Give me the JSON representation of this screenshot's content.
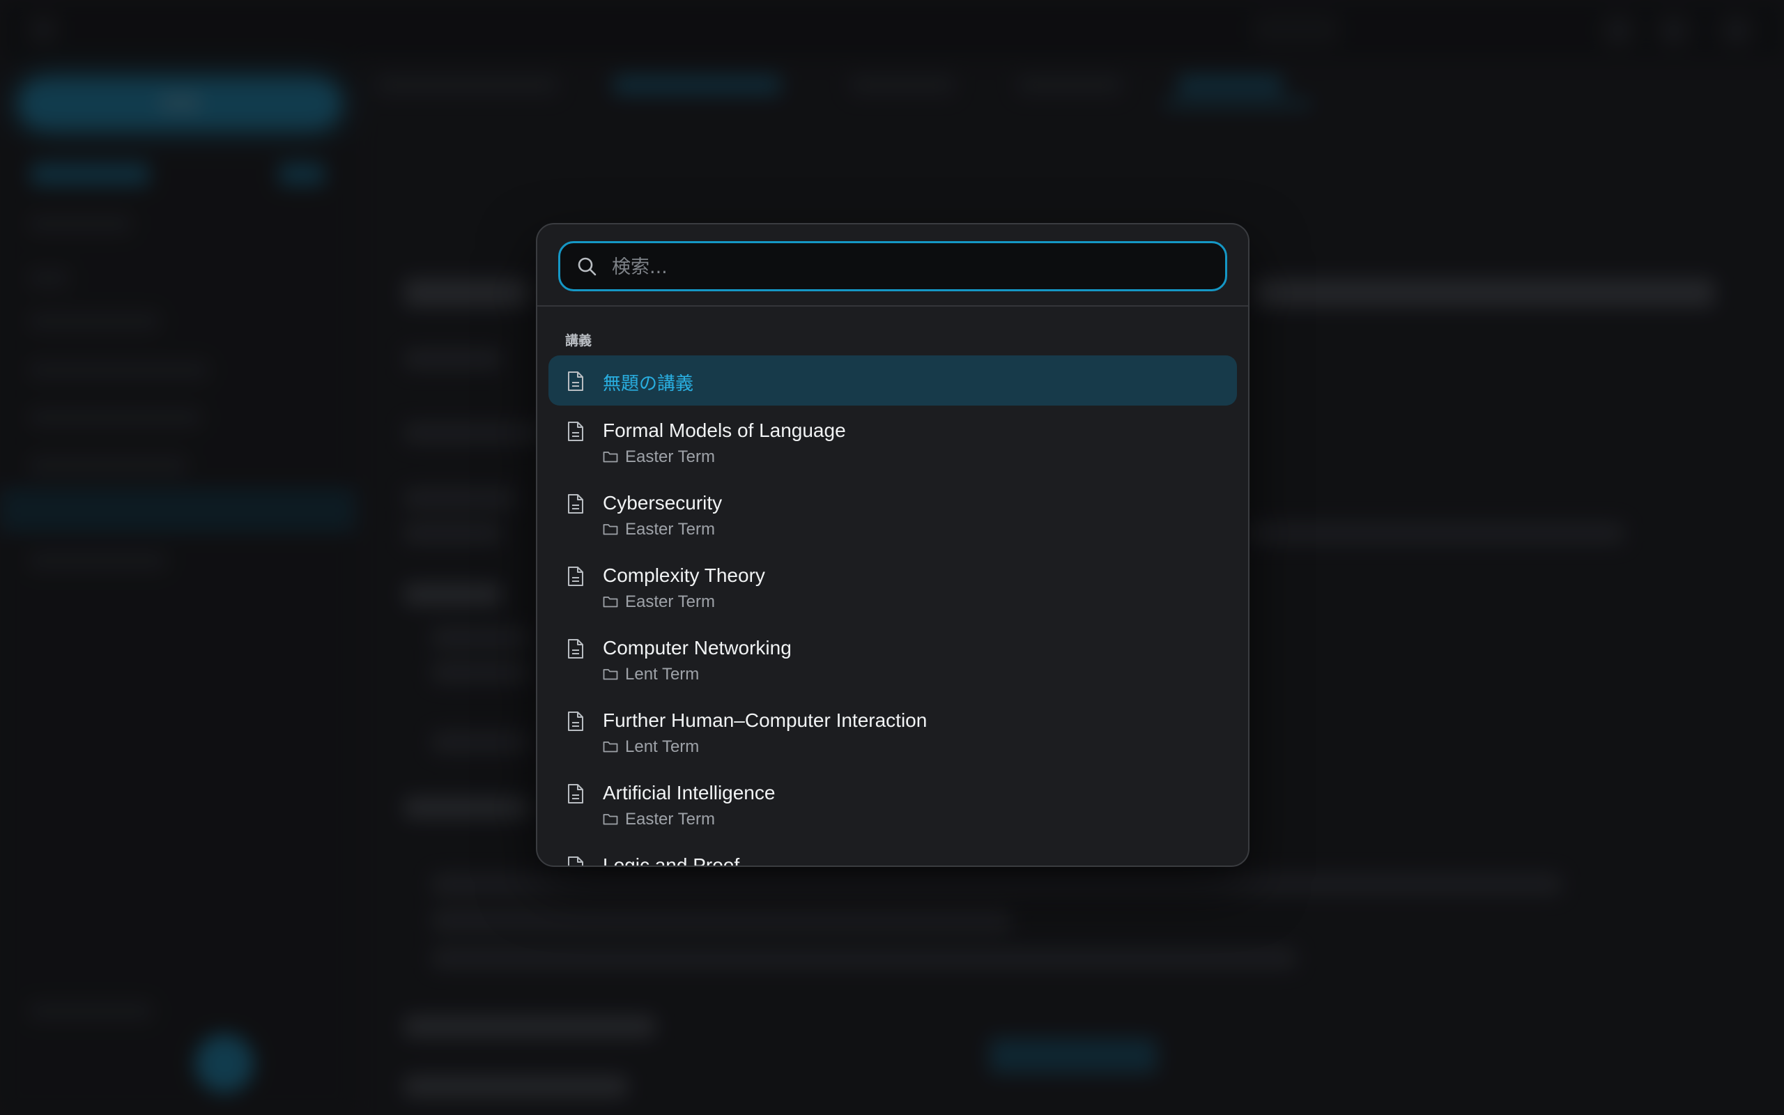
{
  "palette": {
    "search_placeholder": "検索...",
    "section_label": "講義",
    "items": [
      {
        "title": "無題の講義",
        "folder": "",
        "selected": true
      },
      {
        "title": "Formal Models of Language",
        "folder": "Easter Term"
      },
      {
        "title": "Cybersecurity",
        "folder": "Easter Term"
      },
      {
        "title": "Complexity Theory",
        "folder": "Easter Term"
      },
      {
        "title": "Computer Networking",
        "folder": "Lent Term"
      },
      {
        "title": "Further Human–Computer Interaction",
        "folder": "Lent Term"
      },
      {
        "title": "Artificial Intelligence",
        "folder": "Easter Term"
      },
      {
        "title": "Logic and Proof",
        "folder": ""
      }
    ]
  },
  "background": {
    "new_button_label": "新規"
  },
  "colors": {
    "accent": "#1ba4d8",
    "selected_bg": "#173a4a",
    "palette_bg": "#1c1d20"
  }
}
